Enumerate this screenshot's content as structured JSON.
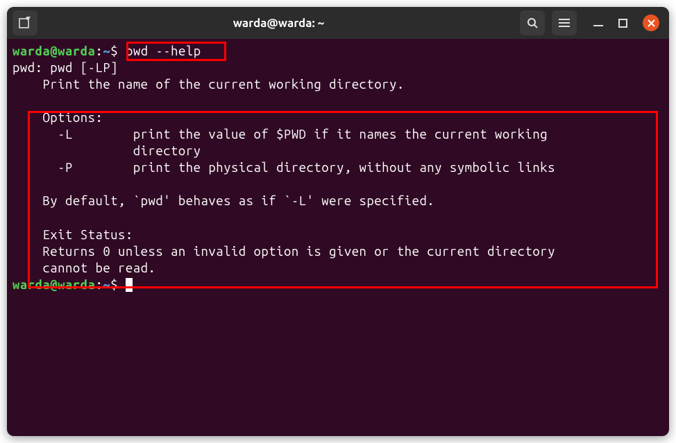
{
  "titlebar": {
    "title": "warda@warda: ~"
  },
  "prompt": {
    "user_host": "warda@warda",
    "separator": ":",
    "path": "~",
    "symbol": "$"
  },
  "command1": "pwd --help",
  "output": {
    "usage_prefix": "pwd: pwd [-LP]",
    "desc": "    Print the name of the current working directory.",
    "blank1": "    ",
    "options_header": "    Options:",
    "opt_L_1": "      -L        print the value of $PWD if it names the current working",
    "opt_L_2": "                directory",
    "opt_P": "      -P        print the physical directory, without any symbolic links",
    "blank2": "    ",
    "default": "    By default, `pwd' behaves as if `-L' were specified.",
    "blank3": "    ",
    "exit_header": "    Exit Status:",
    "exit_1": "    Returns 0 unless an invalid option is given or the current directory",
    "exit_2": "    cannot be read."
  }
}
